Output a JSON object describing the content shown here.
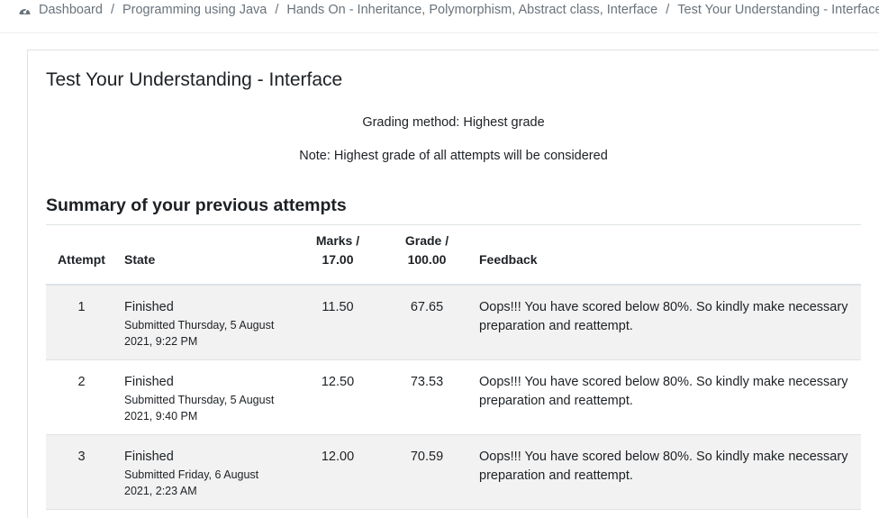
{
  "breadcrumb": {
    "items": [
      "Dashboard",
      "Programming using Java",
      "Hands On - Inheritance, Polymorphism, Abstract class, Interface",
      "Test Your Understanding - Interface"
    ],
    "separator": "/"
  },
  "page": {
    "title": "Test Your Understanding - Interface",
    "grading_method": "Grading method: Highest grade",
    "note": "Note: Highest grade of all attempts will be considered"
  },
  "summary": {
    "heading": "Summary of your previous attempts",
    "columns": {
      "attempt": "Attempt",
      "state": "State",
      "marks_line1": "Marks /",
      "marks_line2": "17.00",
      "grade_line1": "Grade /",
      "grade_line2": "100.00",
      "feedback": "Feedback"
    },
    "rows": [
      {
        "attempt": "1",
        "state": "Finished",
        "submitted": "Submitted Thursday, 5 August 2021, 9:22 PM",
        "marks": "11.50",
        "grade": "67.65",
        "feedback": "Oops!!! You have scored below 80%.  So kindly make necessary preparation and reattempt."
      },
      {
        "attempt": "2",
        "state": "Finished",
        "submitted": "Submitted Thursday, 5 August 2021, 9:40 PM",
        "marks": "12.50",
        "grade": "73.53",
        "feedback": "Oops!!! You have scored below 80%.  So kindly make necessary preparation and reattempt."
      },
      {
        "attempt": "3",
        "state": "Finished",
        "submitted": "Submitted Friday, 6 August 2021, 2:23 AM",
        "marks": "12.00",
        "grade": "70.59",
        "feedback": "Oops!!! You have scored below 80%.  So kindly make necessary preparation and reattempt."
      }
    ]
  },
  "icons": {
    "dashboard": "dashboard-gauge-icon"
  },
  "colors": {
    "text": "#1d2125",
    "muted": "#6a737b",
    "row_stripe": "#f2f2f2",
    "border": "#dee2e6"
  }
}
